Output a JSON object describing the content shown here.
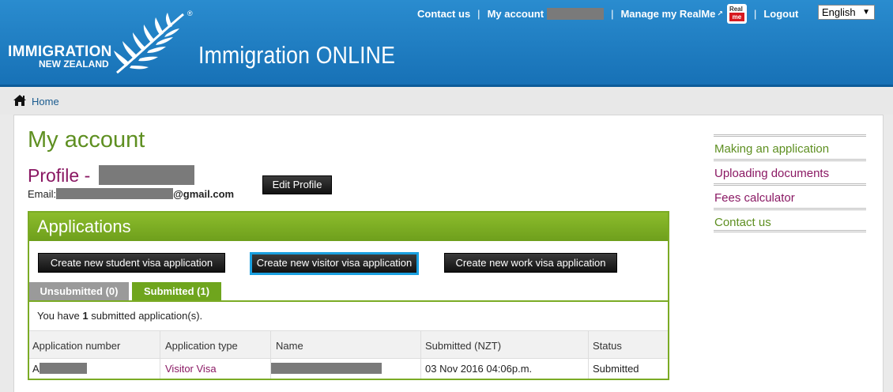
{
  "header": {
    "logo_line1": "IMMIGRATION",
    "logo_line2": "NEW ZEALAND",
    "registered_mark": "®",
    "app_title": "Immigration ONLINE",
    "nav": {
      "contact": "Contact us",
      "my_account": "My account",
      "manage_realme": "Manage my RealMe",
      "realme_badge_top": "Real",
      "realme_badge_bottom": "me",
      "logout": "Logout",
      "separator": "|"
    },
    "language": "English",
    "language_arrow": "▼"
  },
  "breadcrumb": {
    "home": "Home"
  },
  "main": {
    "title": "My account",
    "profile_label": "Profile -",
    "email_prefix": "Email:",
    "email_domain": "@gmail.com",
    "edit_profile": "Edit Profile"
  },
  "applications": {
    "heading": "Applications",
    "buttons": {
      "student": "Create new student visa application",
      "visitor": "Create new visitor visa application",
      "work": "Create new work visa application"
    },
    "tabs": {
      "unsubmitted": "Unsubmitted (0)",
      "submitted": "Submitted (1)"
    },
    "summary_prefix": "You have",
    "summary_count": "1",
    "summary_suffix": "submitted application(s).",
    "columns": [
      "Application number",
      "Application type",
      "Name",
      "Submitted (NZT)",
      "Status"
    ],
    "rows": [
      {
        "number_prefix": "A",
        "type": "Visitor Visa",
        "submitted": "03 Nov 2016 04:06p.m.",
        "status": "Submitted"
      }
    ]
  },
  "sidebar": {
    "links": [
      "Making an application",
      "Uploading documents",
      "Fees calculator",
      "Contact us"
    ],
    "colors": [
      "#5e8f21",
      "#8a1863",
      "#8a1863",
      "#5e8f21"
    ]
  },
  "colors": {
    "header_blue": "#1771b6",
    "green": "#6fa51d",
    "title_green": "#5e8f21",
    "profile_purple": "#8a1863",
    "focus_blue": "#1aa0e0"
  }
}
